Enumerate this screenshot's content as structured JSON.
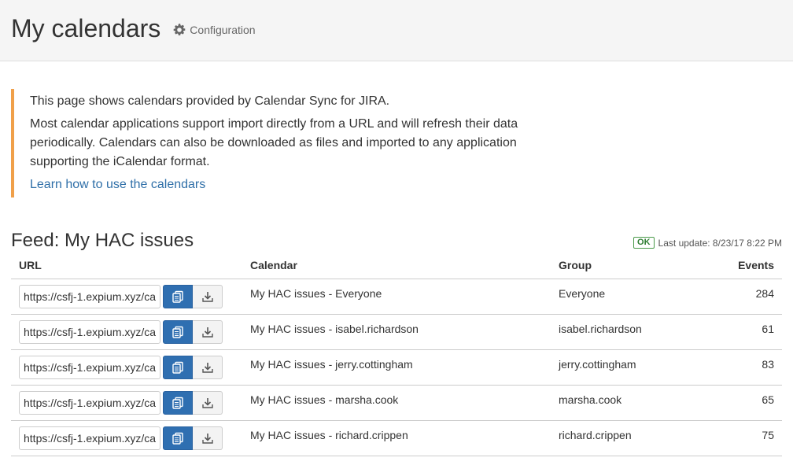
{
  "header": {
    "title": "My calendars",
    "config_label": "Configuration"
  },
  "info": {
    "line1": "This page shows calendars provided by Calendar Sync for JIRA.",
    "line2": "Most calendar applications support import directly from a URL and will refresh their data periodically. Calendars can also be downloaded as files and imported to any application supporting the iCalendar format.",
    "link_label": "Learn how to use the calendars"
  },
  "feed": {
    "title": "Feed: My HAC issues",
    "status_badge": "OK",
    "last_update": "Last update: 8/23/17 8:22 PM",
    "columns": {
      "url": "URL",
      "calendar": "Calendar",
      "group": "Group",
      "events": "Events"
    },
    "rows": [
      {
        "url": "https://csfj-1.expium.xyz/ca",
        "calendar": "My HAC issues - Everyone",
        "group": "Everyone",
        "events": "284"
      },
      {
        "url": "https://csfj-1.expium.xyz/ca",
        "calendar": "My HAC issues - isabel.richardson",
        "group": "isabel.richardson",
        "events": "61"
      },
      {
        "url": "https://csfj-1.expium.xyz/ca",
        "calendar": "My HAC issues - jerry.cottingham",
        "group": "jerry.cottingham",
        "events": "83"
      },
      {
        "url": "https://csfj-1.expium.xyz/ca",
        "calendar": "My HAC issues - marsha.cook",
        "group": "marsha.cook",
        "events": "65"
      },
      {
        "url": "https://csfj-1.expium.xyz/ca",
        "calendar": "My HAC issues - richard.crippen",
        "group": "richard.crippen",
        "events": "75"
      }
    ]
  },
  "icons": {
    "config": "gear-icon",
    "copy": "copy-icon",
    "download": "download-icon"
  },
  "colors": {
    "accent_border": "#f0a04a",
    "link": "#2f6fa8",
    "primary_button": "#2f6fb1",
    "ok_badge": "#2e7d32"
  }
}
